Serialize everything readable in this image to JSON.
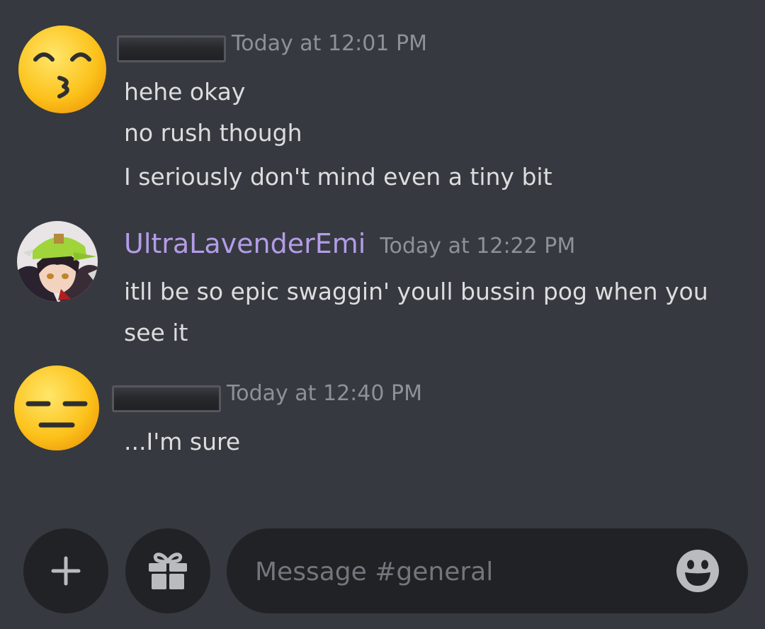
{
  "messages": [
    {
      "author": "",
      "author_redacted": true,
      "timestamp": "Today at 12:01 PM",
      "avatar_icon": "kissing-face-emoji-icon",
      "lines": [
        "hehe okay",
        "no rush though",
        "I seriously don't mind even a tiny bit"
      ]
    },
    {
      "author": "UltraLavenderEmi",
      "author_redacted": false,
      "author_color": "#b49ce8",
      "timestamp": "Today at 12:22 PM",
      "avatar_icon": "anime-character-avatar-icon",
      "lines": [
        "itll be so epic swaggin' youll bussin pog when you",
        "see it"
      ]
    },
    {
      "author": "",
      "author_redacted": true,
      "timestamp": "Today at 12:40 PM",
      "avatar_icon": "expressionless-face-emoji-icon",
      "lines": [
        "...I'm sure"
      ]
    }
  ],
  "composer": {
    "add_icon": "plus-icon",
    "gift_icon": "gift-icon",
    "placeholder": "Message #general",
    "emoji_icon": "smiley-face-icon"
  },
  "colors": {
    "background": "#36393f",
    "input_background": "#202225",
    "text": "#dcddde",
    "timestamp": "#8e9297",
    "username": "#b49ce8"
  }
}
